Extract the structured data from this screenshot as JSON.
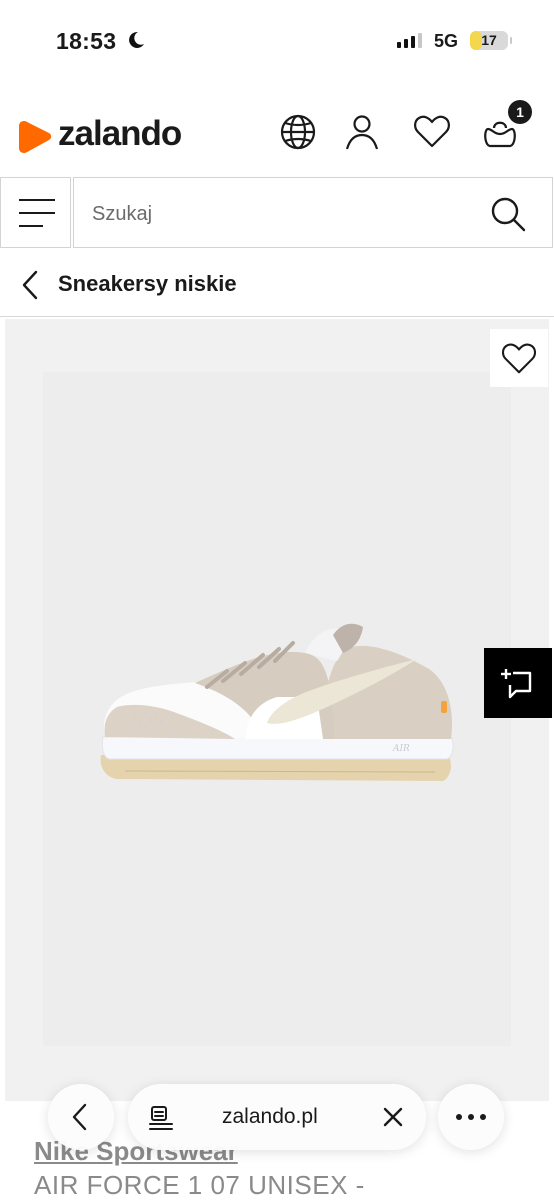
{
  "status_bar": {
    "time": "18:53",
    "network": "5G",
    "battery": "17",
    "battery_level_percent": 17,
    "signal_bars_active": 3,
    "signal_bars_total": 4,
    "focus_icon": "moon-icon"
  },
  "header": {
    "logo_text": "zalando",
    "brand_color": "#ff6900",
    "icons": [
      "globe-icon",
      "user-icon",
      "heart-icon",
      "bag-icon"
    ],
    "bag_count": "1"
  },
  "search": {
    "placeholder": "Szukaj",
    "menu_icon": "menu-icon",
    "search_icon": "search-icon"
  },
  "category": {
    "title": "Sneakersy niskie",
    "back_icon": "chevron-left-icon"
  },
  "product": {
    "image_alt": "Nike Air Force 1 sneaker, white and beige",
    "brand": "Nike Sportswear",
    "name": "AIR FORCE 1 07 UNISEX -",
    "wishlist_icon": "heart-icon",
    "compare_icon": "compare-icon"
  },
  "browser_bar": {
    "url": "zalando.pl",
    "icons": [
      "chevron-left-icon",
      "reader-icon",
      "close-icon",
      "more-icon"
    ]
  },
  "colors": {
    "brand_orange": "#ff6900",
    "text_dark": "#1a1a1a",
    "battery_yellow": "#f3d84d"
  }
}
